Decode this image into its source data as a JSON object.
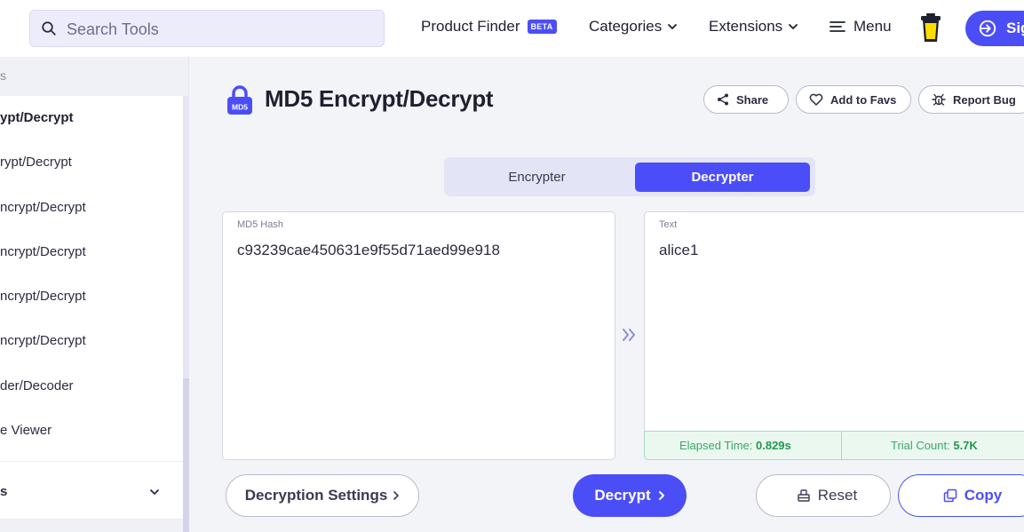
{
  "header": {
    "search_placeholder": "Search Tools",
    "nav": {
      "product_finder": "Product Finder",
      "beta_badge": "BETA",
      "categories": "Categories",
      "extensions": "Extensions",
      "menu": "Menu"
    },
    "signin_label": "Sig"
  },
  "sidebar": {
    "section_label": "s",
    "items": [
      {
        "label": "ypt/Decrypt",
        "active": true
      },
      {
        "label": "rypt/Decrypt"
      },
      {
        "label": "ncrypt/Decrypt"
      },
      {
        "label": "ncrypt/Decrypt"
      },
      {
        "label": "ncrypt/Decrypt"
      },
      {
        "label": "ncrypt/Decrypt"
      },
      {
        "label": "der/Decoder"
      },
      {
        "label": "e Viewer"
      }
    ],
    "group_label": "s"
  },
  "main": {
    "title_icon_text": "MD5",
    "title": "MD5 Encrypt/Decrypt",
    "actions": {
      "share": "Share",
      "add_to_favs": "Add to Favs",
      "report_bug": "Report Bug"
    },
    "tabs": {
      "encrypter": "Encrypter",
      "decrypter": "Decrypter",
      "active": "Decrypter"
    },
    "input_panel": {
      "label": "MD5 Hash",
      "value": "c93239cae450631e9f55d71aed99e918"
    },
    "output_panel": {
      "label": "Text",
      "value": "alice1"
    },
    "stats": {
      "elapsed_label": "Elapsed Time:",
      "elapsed_value": "0.829s",
      "trial_label": "Trial Count:",
      "trial_value": "5.7K"
    },
    "buttons": {
      "settings": "Decryption Settings",
      "decrypt": "Decrypt",
      "reset": "Reset",
      "copy": "Copy"
    }
  },
  "colors": {
    "accent": "#4b4ef7",
    "success": "#20994f",
    "background": "#f3f4f8"
  }
}
